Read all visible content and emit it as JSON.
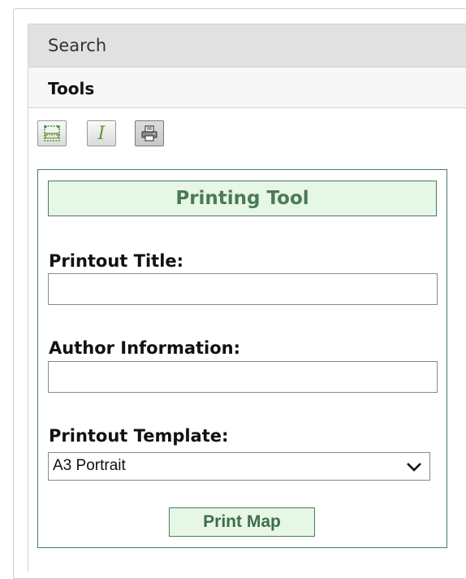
{
  "accordion": {
    "search_label": "Search",
    "tools_label": "Tools"
  },
  "toolbar": {
    "buttons": [
      {
        "icon": "measure-ruler-icon"
      },
      {
        "icon": "identify-italic-icon",
        "glyph": "I"
      },
      {
        "icon": "printer-icon"
      }
    ]
  },
  "printing_tool": {
    "title": "Printing Tool",
    "printout_title_label": "Printout Title:",
    "printout_title_value": "",
    "author_label": "Author Information:",
    "author_value": "",
    "template_label": "Printout Template:",
    "template_selected": "A3 Portrait",
    "print_button_label": "Print Map"
  },
  "colors": {
    "accent_green": "#4b7a55",
    "panel_fill_green": "#e6f7e6",
    "border_green": "#4a7c64"
  }
}
